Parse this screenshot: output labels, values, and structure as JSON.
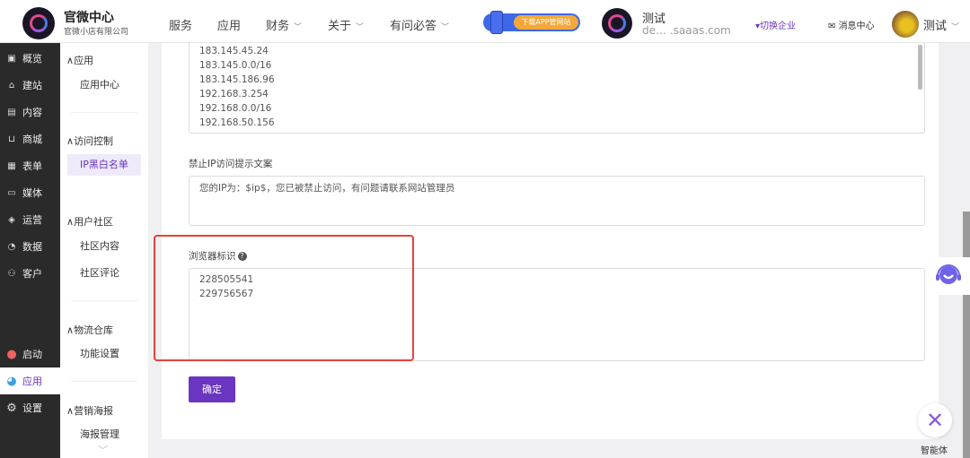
{
  "header": {
    "brand": "官微中心",
    "company": "官微小店有限公司",
    "nav": [
      "服务",
      "应用",
      "财务",
      "关于",
      "有问必答"
    ],
    "banner": "下载APP管网站",
    "org_name": "测试",
    "org_email": "de… .saaas.com",
    "switch": "▾切换企业",
    "messages": "消息中心",
    "user": "测试"
  },
  "sidebar1": {
    "items": [
      {
        "icon": "overview-icon",
        "glyph": "▣",
        "label": "概览"
      },
      {
        "icon": "home-icon",
        "glyph": "⌂",
        "label": "建站"
      },
      {
        "icon": "document-icon",
        "glyph": "▤",
        "label": "内容"
      },
      {
        "icon": "cart-icon",
        "glyph": "⊔",
        "label": "商城"
      },
      {
        "icon": "form-icon",
        "glyph": "▦",
        "label": "表单"
      },
      {
        "icon": "video-icon",
        "glyph": "▭",
        "label": "媒体"
      },
      {
        "icon": "tag-icon",
        "glyph": "◈",
        "label": "运营"
      },
      {
        "icon": "chart-icon",
        "glyph": "◔",
        "label": "数据"
      },
      {
        "icon": "user-icon",
        "glyph": "⚇",
        "label": "客户"
      }
    ],
    "launch": "启动",
    "apps": "应用",
    "settings": "设置"
  },
  "sidebar2": {
    "groups": [
      "应用",
      "访问控制",
      "用户社区",
      "物流仓库",
      "营销海报"
    ],
    "items": [
      "应用中心",
      "IP黑白名单",
      "社区内容",
      "社区评论",
      "功能设置",
      "海报管理"
    ]
  },
  "form": {
    "ip_list": "183.145.45.24\n183.145.0.0/16\n183.145.186.96\n192.168.3.254\n192.168.0.0/16\n192.168.50.156",
    "deny_label": "禁止IP访问提示文案",
    "deny_text": "您的IP为：$ip$，您已被禁止访问，有问题请联系网站管理员",
    "ua_label": "浏览器标识",
    "ua_text": "228505541\n229756567",
    "submit": "确定"
  },
  "floating": {
    "agent": "智能体"
  },
  "colors": {
    "accent": "#6a35c0",
    "highlight": "#e8413a"
  }
}
